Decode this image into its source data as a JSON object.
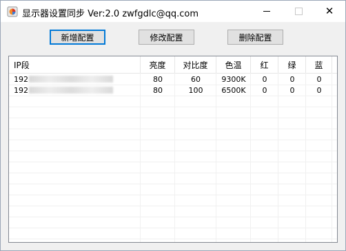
{
  "window": {
    "title": "显示器设置同步  Ver:2.0 zwfgdlc@qq.com",
    "controls": {
      "minimize": "minimize",
      "maximize": "maximize",
      "close": "✕"
    }
  },
  "toolbar": {
    "add_label": "新增配置",
    "edit_label": "修改配置",
    "delete_label": "删除配置"
  },
  "table": {
    "columns": [
      "IP段",
      "亮度",
      "对比度",
      "色温",
      "红",
      "绿",
      "蓝"
    ],
    "rows": [
      {
        "ip": "192",
        "brightness": "80",
        "contrast": "60",
        "color_temp": "9300K",
        "red": "0",
        "green": "0",
        "blue": "0"
      },
      {
        "ip": "192",
        "brightness": "80",
        "contrast": "100",
        "color_temp": "6500K",
        "red": "0",
        "green": "0",
        "blue": "0"
      }
    ]
  }
}
